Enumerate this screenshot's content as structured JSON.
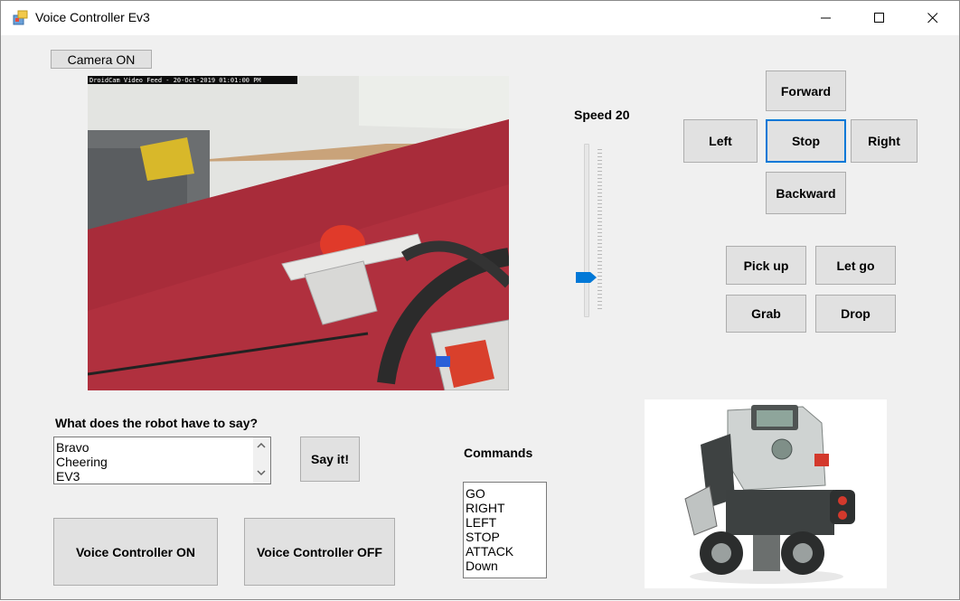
{
  "window": {
    "title": "Voice Controller Ev3"
  },
  "camera": {
    "toggle_label": "Camera ON",
    "overlay_text": "DroidCam Video Feed - 20-Oct-2019 01:01:00 PM"
  },
  "speed": {
    "label": "Speed 20",
    "value": 20
  },
  "direction": {
    "forward": "Forward",
    "left": "Left",
    "stop": "Stop",
    "right": "Right",
    "backward": "Backward"
  },
  "gripper": {
    "pick_up": "Pick up",
    "let_go": "Let go",
    "grab": "Grab",
    "drop": "Drop"
  },
  "say": {
    "label": "What does the robot have to say?",
    "options": [
      "Bravo",
      "Cheering",
      "EV3"
    ],
    "button": "Say it!"
  },
  "commands": {
    "label": "Commands",
    "items": [
      "GO",
      "RIGHT",
      "LEFT",
      "STOP",
      "ATTACK",
      "Down"
    ]
  },
  "voice": {
    "on": "Voice Controller ON",
    "off": "Voice Controller OFF"
  }
}
